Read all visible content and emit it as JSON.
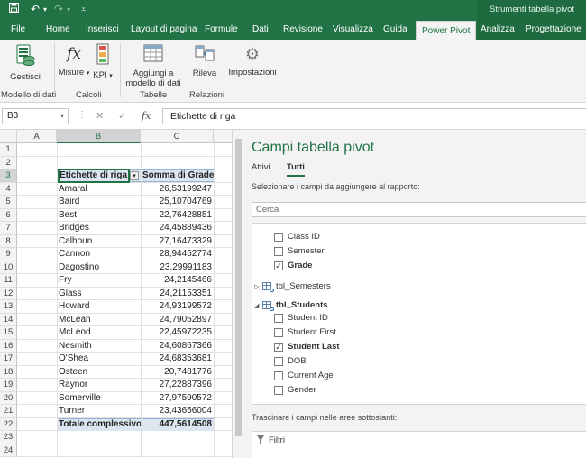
{
  "context_title": "Strumenti tabella pivot",
  "tabs": [
    {
      "label": "File",
      "left": 0
    },
    {
      "label": "Home",
      "left": 0
    },
    {
      "label": "Inserisci",
      "left": 0
    },
    {
      "label": "Layout di pagina",
      "left": 0
    },
    {
      "label": "Formule",
      "left": 0
    },
    {
      "label": "Dati",
      "left": 0
    },
    {
      "label": "Revisione",
      "left": 0
    },
    {
      "label": "Visualizza",
      "left": 0
    },
    {
      "label": "Guida",
      "left": 0
    },
    {
      "label": "Power Pivot",
      "left": 0
    },
    {
      "label": "Analizza",
      "left": 0
    },
    {
      "label": "Progettazione",
      "left": 0
    }
  ],
  "ribbon": {
    "gestisci": "Gestisci",
    "misure": "Misure",
    "kpi": "KPI",
    "aggiungi": "Aggiungi a",
    "aggiungi2": "modello di dati",
    "rileva": "Rileva",
    "impostazioni": "Impostazioni",
    "g_modello": "Modello di dati",
    "g_calcoli": "Calcoli",
    "g_tabelle": "Tabelle",
    "g_relazioni": "Relazioni"
  },
  "formula_bar": {
    "name_box": "B3",
    "formula": "Etichette di riga"
  },
  "grid": {
    "columns": [
      "A",
      "B",
      "C"
    ],
    "rows": [
      "1",
      "2",
      "3",
      "4",
      "5",
      "6",
      "7",
      "8",
      "9",
      "10",
      "11",
      "12",
      "13",
      "14",
      "15",
      "16",
      "17",
      "18",
      "19",
      "20",
      "21",
      "22",
      "23",
      "24"
    ],
    "header_label": "Etichette di riga",
    "header_value": "Somma di Grade",
    "data": [
      {
        "name": "Amaral",
        "value": "26,53199247"
      },
      {
        "name": "Baird",
        "value": "25,10704769"
      },
      {
        "name": "Best",
        "value": "22,76428851"
      },
      {
        "name": "Bridges",
        "value": "24,45889436"
      },
      {
        "name": "Calhoun",
        "value": "27,16473329"
      },
      {
        "name": "Cannon",
        "value": "28,94452774"
      },
      {
        "name": "Dagostino",
        "value": "23,29991183"
      },
      {
        "name": "Fry",
        "value": "24,2145466"
      },
      {
        "name": "Glass",
        "value": "24,21153351"
      },
      {
        "name": "Howard",
        "value": "24,93199572"
      },
      {
        "name": "McLean",
        "value": "24,79052897"
      },
      {
        "name": "McLeod",
        "value": "22,45972235"
      },
      {
        "name": "Nesmith",
        "value": "24,60867366"
      },
      {
        "name": "O'Shea",
        "value": "24,68353681"
      },
      {
        "name": "Osteen",
        "value": "20,7481776"
      },
      {
        "name": "Raynor",
        "value": "27,22887396"
      },
      {
        "name": "Somerville",
        "value": "27,97590572"
      },
      {
        "name": "Turner",
        "value": "23,43656004"
      }
    ],
    "total_label": "Totale complessivo",
    "total_value": "447,5614508"
  },
  "pivot": {
    "title": "Campi tabella pivot",
    "tab_active": "Attivi",
    "tab_all": "Tutti",
    "choose_label": "Selezionare i campi da aggiungere al rapporto:",
    "search_placeholder": "Cerca",
    "fields": [
      {
        "label": "Class ID",
        "checked": false,
        "bold": false
      },
      {
        "label": "Semester",
        "checked": false,
        "bold": false
      },
      {
        "label": "Grade",
        "checked": true,
        "bold": true
      }
    ],
    "table1": "tbl_Semesters",
    "table2": "tbl_Students",
    "student_fields": [
      {
        "label": "Student ID",
        "checked": false,
        "bold": false
      },
      {
        "label": "Student First",
        "checked": false,
        "bold": false
      },
      {
        "label": "Student Last",
        "checked": true,
        "bold": true
      },
      {
        "label": "DOB",
        "checked": false,
        "bold": false
      },
      {
        "label": "Current Age",
        "checked": false,
        "bold": false
      },
      {
        "label": "Gender",
        "checked": false,
        "bold": false
      }
    ],
    "drag_label": "Trascinare i campi nelle aree sottostanti:",
    "filters_label": "Filtri"
  },
  "colors": {
    "accent": "#217346",
    "pivot_header": "#dce6f1"
  }
}
